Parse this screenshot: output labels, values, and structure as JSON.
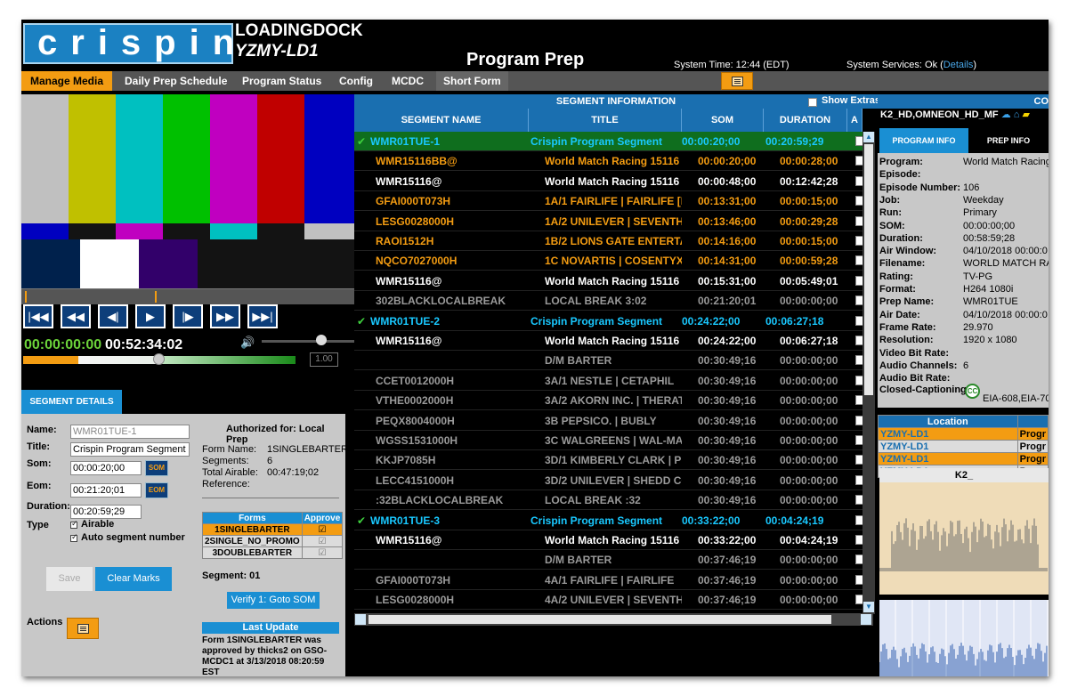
{
  "header": {
    "logo_text": "crispin",
    "location": "LOADINGDOCK",
    "station": "YZMY-LD1",
    "app_title": "Program Prep",
    "system_time": "System Time: 12:44 (EDT)",
    "system_services": "System Services: Ok (",
    "system_services_link": "Details",
    "system_services_end": ")"
  },
  "nav": {
    "tabs": [
      "Manage Media",
      "Daily Prep Schedule",
      "Program Status",
      "Config",
      "MCDC",
      "Short Form"
    ]
  },
  "player": {
    "current_timecode": "00:00:00:00",
    "duration_timecode": "00:52:34:02",
    "zoom_value": "1.00",
    "transport": [
      "|◀◀",
      "◀◀",
      "◀|",
      "▶",
      "|▶",
      "▶▶",
      "▶▶|"
    ]
  },
  "segment_details": {
    "tab_label": "SEGMENT DETAILS",
    "name_label": "Name:",
    "name_value": "WMR01TUE-1",
    "title_label": "Title:",
    "title_value": "Crispin Program Segment",
    "som_label": "Som:",
    "som_value": "00:00:20;00",
    "som_btn": "SOM",
    "eom_label": "Eom:",
    "eom_value": "00:21:20;01",
    "eom_btn": "EOM",
    "duration_label": "Duration:",
    "duration_value": "00:20:59;29",
    "type_label": "Type",
    "airable_label": "Airable",
    "auto_seg_label": "Auto segment number",
    "save_label": "Save",
    "clear_marks_label": "Clear Marks",
    "actions_label": "Actions",
    "authorized": "Authorized for: Local Prep",
    "form_name_label": "Form Name:",
    "form_name_value": "1SINGLEBARTER",
    "segments_label": "Segments:",
    "segments_value": "6",
    "total_airable_label": "Total Airable:",
    "total_airable_value": "00:47:19;02",
    "reference_label": "Reference:",
    "forms_header": "Forms",
    "approve_header": "Approve",
    "forms": [
      "1SINGLEBARTER",
      "2SINGLE_NO_PROMO",
      "3DOUBLEBARTER"
    ],
    "segment_label": "Segment: 01",
    "verify_label": "Verify 1: Goto SOM",
    "last_update_header": "Last Update",
    "last_update_text": "Form 1SINGLEBARTER was approved by thicks2 on GSO-MCDC1 at 3/13/2018 08:20:59 EST"
  },
  "segment_info": {
    "header": "SEGMENT INFORMATION",
    "show_extras": "Show Extras",
    "columns": [
      "SEGMENT NAME",
      "TITLE",
      "SOM",
      "DURATION",
      "A"
    ],
    "rows": [
      {
        "kind": "seg",
        "name": "WMR01TUE-1",
        "title": "Crispin Program Segment",
        "som": "00:00:20;00",
        "dur": "00:20:59;29"
      },
      {
        "kind": "orange",
        "name": "WMR15116BB@",
        "title": "World Match Racing 15116",
        "som": "00:00:20;00",
        "dur": "00:00:28;00"
      },
      {
        "kind": "white",
        "name": "WMR15116@",
        "title": "World Match Racing 15116",
        "som": "00:00:48;00",
        "dur": "00:12:42;28"
      },
      {
        "kind": "orange",
        "name": "GFAI000T073H",
        "title": "1A/1 FAIRLIFE | FAIRLIFE [N",
        "som": "00:13:31;00",
        "dur": "00:00:15;00"
      },
      {
        "kind": "orange",
        "name": "LESG0028000H",
        "title": "1A/2 UNILEVER | SEVENTH G",
        "som": "00:13:46;00",
        "dur": "00:00:29;28"
      },
      {
        "kind": "orange",
        "name": "RAOI1512H",
        "title": "1B/2 LIONS GATE ENTERTAI",
        "som": "00:14:16;00",
        "dur": "00:00:15;00"
      },
      {
        "kind": "orange",
        "name": "NQCO7027000H",
        "title": "1C NOVARTIS | COSENTYX [",
        "som": "00:14:31;00",
        "dur": "00:00:59;28"
      },
      {
        "kind": "white",
        "name": "WMR15116@",
        "title": "World Match Racing 15116",
        "som": "00:15:31;00",
        "dur": "00:05:49;01"
      },
      {
        "kind": "gray",
        "name": "302BLACKLOCALBREAK",
        "title": "LOCAL BREAK 3:02",
        "som": "00:21:20;01",
        "dur": "00:00:00;00"
      },
      {
        "kind": "seg2",
        "name": "WMR01TUE-2",
        "title": "Crispin Program Segment",
        "som": "00:24:22;00",
        "dur": "00:06:27;18"
      },
      {
        "kind": "white",
        "name": "WMR15116@",
        "title": "World Match Racing 15116",
        "som": "00:24:22;00",
        "dur": "00:06:27;18"
      },
      {
        "kind": "gray",
        "name": "",
        "title": "D/M BARTER",
        "som": "00:30:49;16",
        "dur": "00:00:00;00"
      },
      {
        "kind": "gray",
        "name": "CCET0012000H",
        "title": "3A/1 NESTLE | CETAPHIL",
        "som": "00:30:49;16",
        "dur": "00:00:00;00"
      },
      {
        "kind": "gray",
        "name": "VTHE0002000H",
        "title": "3A/2 AKORN INC. | THERAT",
        "som": "00:30:49;16",
        "dur": "00:00:00;00"
      },
      {
        "kind": "gray",
        "name": "PEQX8004000H",
        "title": "3B PEPSICO. | BUBLY",
        "som": "00:30:49;16",
        "dur": "00:00:00;00"
      },
      {
        "kind": "gray",
        "name": "WGSS1531000H",
        "title": "3C WALGREENS | WAL-MART",
        "som": "00:30:49;16",
        "dur": "00:00:00;00"
      },
      {
        "kind": "gray",
        "name": "KKJP7085H",
        "title": "3D/1 KIMBERLY CLARK | PU",
        "som": "00:30:49;16",
        "dur": "00:00:00;00"
      },
      {
        "kind": "gray",
        "name": "LECC4151000H",
        "title": "3D/2 UNILEVER | SHEDD CO",
        "som": "00:30:49;16",
        "dur": "00:00:00;00"
      },
      {
        "kind": "gray",
        "name": ":32BLACKLOCALBREAK",
        "title": "LOCAL BREAK :32",
        "som": "00:30:49;16",
        "dur": "00:00:00;00"
      },
      {
        "kind": "seg2",
        "name": "WMR01TUE-3",
        "title": "Crispin Program Segment",
        "som": "00:33:22;00",
        "dur": "00:04:24;19"
      },
      {
        "kind": "white",
        "name": "WMR15116@",
        "title": "World Match Racing 15116",
        "som": "00:33:22;00",
        "dur": "00:04:24;19"
      },
      {
        "kind": "gray",
        "name": "",
        "title": "D/M BARTER",
        "som": "00:37:46;19",
        "dur": "00:00:00;00"
      },
      {
        "kind": "gray",
        "name": "GFAI000T073H",
        "title": "4A/1 FAIRLIFE | FAIRLIFE",
        "som": "00:37:46;19",
        "dur": "00:00:00;00"
      },
      {
        "kind": "gray",
        "name": "LESG0028000H",
        "title": "4A/2 UNILEVER | SEVENTH G",
        "som": "00:37:46;19",
        "dur": "00:00:00;00"
      }
    ]
  },
  "right_panel": {
    "header": "CO",
    "device_name": "K2_HD,OMNEON_HD_MF",
    "tab_program_info": "PROGRAM INFO",
    "tab_prep_info": "PREP INFO",
    "info": [
      {
        "k": "Program:",
        "v": "World Match Racing"
      },
      {
        "k": "Episode:",
        "v": ""
      },
      {
        "k": "Episode Number:",
        "v": "106"
      },
      {
        "k": "Job:",
        "v": "Weekday"
      },
      {
        "k": "Run:",
        "v": "Primary"
      },
      {
        "k": "SOM:",
        "v": "00:00:00;00"
      },
      {
        "k": "Duration:",
        "v": "00:58:59;28"
      },
      {
        "k": "Air Window:",
        "v": "04/10/2018 00:00:0"
      },
      {
        "k": "Filename:",
        "v": "WORLD MATCH RA"
      },
      {
        "k": "Rating:",
        "v": "TV-PG"
      },
      {
        "k": "Format:",
        "v": "H264 1080i"
      },
      {
        "k": "Prep Name:",
        "v": "WMR01TUE"
      },
      {
        "k": "Air Date:",
        "v": "04/10/2018 00:00:0"
      },
      {
        "k": "Frame Rate:",
        "v": "29.970"
      },
      {
        "k": "Resolution:",
        "v": "1920 x 1080"
      },
      {
        "k": "Video Bit Rate:",
        "v": ""
      },
      {
        "k": "Audio Channels:",
        "v": "6"
      },
      {
        "k": "Audio Bit Rate:",
        "v": ""
      }
    ],
    "cc_label": "Closed-Captioning:",
    "cc_badge": "CC",
    "cc_value": "EIA-608,EIA-70",
    "location_header": "Location",
    "locations": [
      {
        "loc": "YZMY-LD1",
        "st": "Progr"
      },
      {
        "loc": "YZMY-LD1",
        "st": "Progr"
      },
      {
        "loc": "YZMY-LD1",
        "st": "Progr"
      },
      {
        "loc": "YZMY-LD1",
        "st": "Progr"
      }
    ],
    "wave_title": "K2_"
  }
}
